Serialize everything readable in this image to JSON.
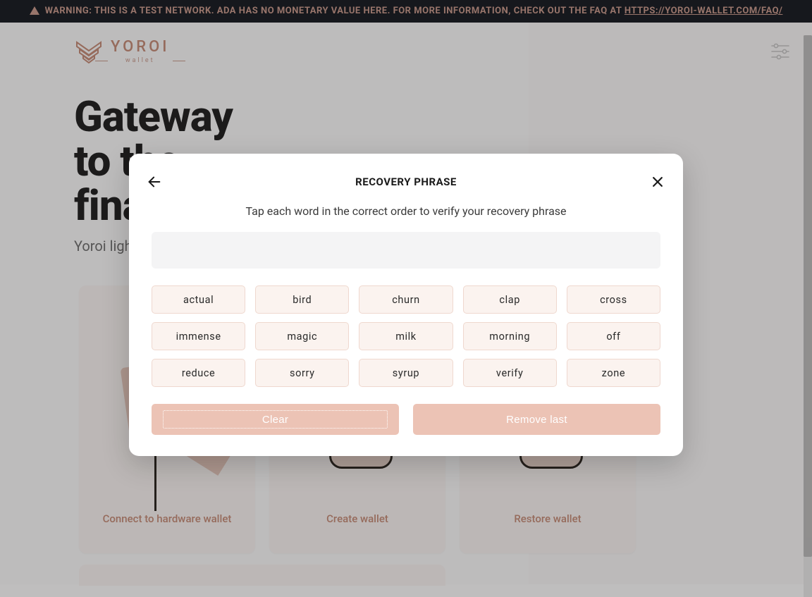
{
  "banner": {
    "prefix": "WARNING: THIS IS A TEST NETWORK. ADA HAS NO MONETARY VALUE HERE. FOR MORE INFORMATION, CHECK OUT THE FAQ AT ",
    "link_text": "HTTPS://YOROI-WALLET.COM/FAQ/"
  },
  "logo": {
    "brand": "YOROI",
    "sub": "wallet"
  },
  "hero": {
    "line1": "Gateway",
    "line2": "to the",
    "line3": "financial world",
    "tagline": "Yoroi light wallet for Cardano assets"
  },
  "cards": [
    {
      "label": "Connect to hardware wallet"
    },
    {
      "label": "Create wallet"
    },
    {
      "label": "Restore wallet"
    }
  ],
  "modal": {
    "title": "RECOVERY PHRASE",
    "subtitle": "Tap each word in the correct order to verify your recovery phrase",
    "words": [
      "actual",
      "bird",
      "churn",
      "clap",
      "cross",
      "immense",
      "magic",
      "milk",
      "morning",
      "off",
      "reduce",
      "sorry",
      "syrup",
      "verify",
      "zone"
    ],
    "clear": "Clear",
    "remove_last": "Remove last"
  },
  "colors": {
    "accent": "#C68C78",
    "accent_light": "#ECC3B5",
    "banner_bg": "#151A20"
  }
}
